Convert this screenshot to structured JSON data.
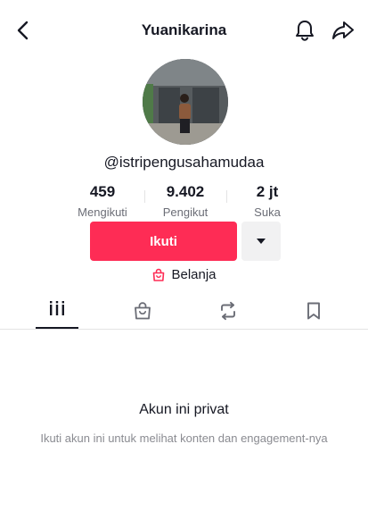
{
  "header": {
    "title": "Yuanikarina",
    "back_icon": "chevron-left-icon",
    "bell_icon": "bell-icon",
    "share_icon": "share-arrow-icon"
  },
  "profile": {
    "username": "@istripengusahamudaa"
  },
  "stats": [
    {
      "value": "459",
      "label": "Mengikuti"
    },
    {
      "value": "9.402",
      "label": "Pengikut"
    },
    {
      "value": "2 jt",
      "label": "Suka"
    }
  ],
  "actions": {
    "follow_label": "Ikuti",
    "follow_color": "#fe2c55",
    "more_icon": "caret-down-icon"
  },
  "shop": {
    "label": "Belanja",
    "icon": "shopping-bag-icon",
    "icon_color": "#fe2c55"
  },
  "tabs": [
    {
      "name": "videos",
      "icon": "grid-bars-icon",
      "active": true
    },
    {
      "name": "shop",
      "icon": "shopping-bag-icon",
      "active": false
    },
    {
      "name": "reposts",
      "icon": "repost-icon",
      "active": false
    },
    {
      "name": "favorites",
      "icon": "bookmark-icon",
      "active": false
    }
  ],
  "private_notice": {
    "title": "Akun ini privat",
    "description": "Ikuti akun ini untuk melihat konten dan engagement-nya"
  }
}
